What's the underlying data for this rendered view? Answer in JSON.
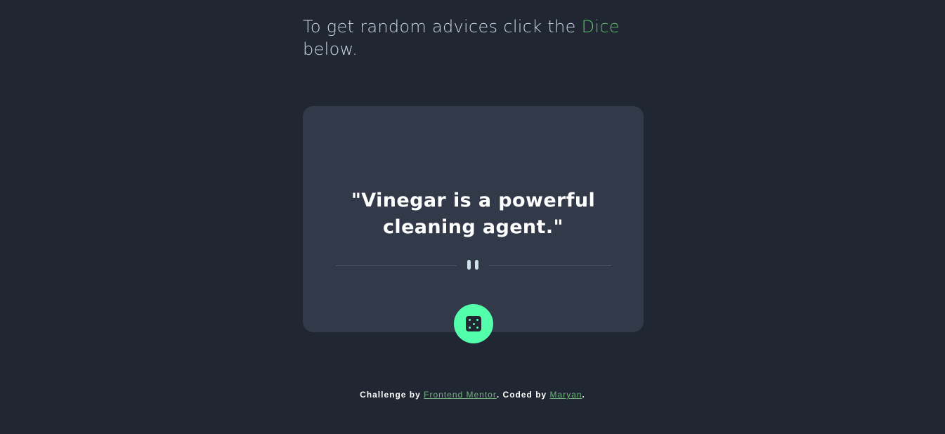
{
  "intro": {
    "text_before": "To get random advices click the ",
    "accent_word": "Dice",
    "text_after": " below."
  },
  "card": {
    "quote": "\"Vinegar is a powerful cleaning agent.\""
  },
  "dice_button": {
    "icon": "dice-icon"
  },
  "footer": {
    "prefix": "Challenge by ",
    "link1": "Frontend Mentor",
    "middle": ". Coded by ",
    "link2": "Maryan",
    "suffix": "."
  },
  "colors": {
    "background": "#202632",
    "card": "#323a49",
    "accent_green": "#53ffaa",
    "link_green": "#6fb37b",
    "text_light": "#cee3e9"
  }
}
